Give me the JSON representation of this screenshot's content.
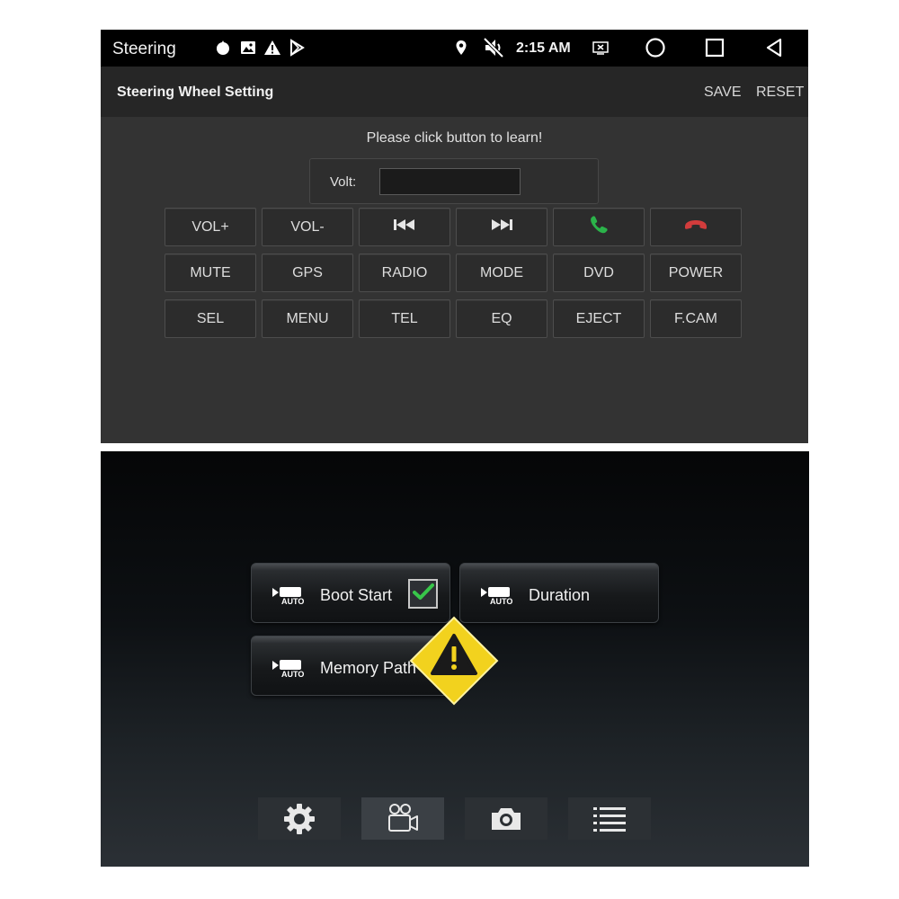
{
  "status_bar": {
    "app_name": "Steering",
    "time": "2:15 AM",
    "icons": [
      "app-indicator-icon",
      "image-icon",
      "warning-icon",
      "play-store-icon",
      "location-icon",
      "mute-icon",
      "screen-icon",
      "home-icon",
      "recents-icon",
      "back-icon"
    ]
  },
  "action_bar": {
    "title": "Steering Wheel Setting",
    "save_label": "SAVE",
    "reset_label": "RESET"
  },
  "learn": {
    "hint": "Please click button to learn!",
    "volt_label": "Volt:",
    "volt_value": ""
  },
  "keys": [
    {
      "label": "VOL+",
      "icon": null
    },
    {
      "label": "VOL-",
      "icon": null
    },
    {
      "label": "",
      "icon": "previous-track-icon"
    },
    {
      "label": "",
      "icon": "next-track-icon"
    },
    {
      "label": "",
      "icon": "call-answer-icon",
      "color": "#2bb34a"
    },
    {
      "label": "",
      "icon": "call-hangup-icon",
      "color": "#d23c3c"
    },
    {
      "label": "MUTE",
      "icon": null
    },
    {
      "label": "GPS",
      "icon": null
    },
    {
      "label": "RADIO",
      "icon": null
    },
    {
      "label": "MODE",
      "icon": null
    },
    {
      "label": "DVD",
      "icon": null
    },
    {
      "label": "POWER",
      "icon": null
    },
    {
      "label": "SEL",
      "icon": null
    },
    {
      "label": "MENU",
      "icon": null
    },
    {
      "label": "TEL",
      "icon": null
    },
    {
      "label": "EQ",
      "icon": null
    },
    {
      "label": "EJECT",
      "icon": null
    },
    {
      "label": "F.CAM",
      "icon": null
    }
  ],
  "dvr": {
    "auto_badge": "AUTO",
    "boot_start": {
      "label": "Boot Start",
      "checked": true
    },
    "duration": {
      "label": "Duration"
    },
    "memory_path": {
      "label": "Memory Path"
    },
    "warning_color": "#f2d21e",
    "tabs": [
      "settings-icon",
      "video-camera-icon",
      "photo-camera-icon",
      "list-icon"
    ],
    "active_tab": "video-camera-icon"
  },
  "colors": {
    "panel_bg": "#333333",
    "action_bar_bg": "#262626",
    "status_bar_bg": "#000000",
    "check_color": "#38c64a"
  }
}
